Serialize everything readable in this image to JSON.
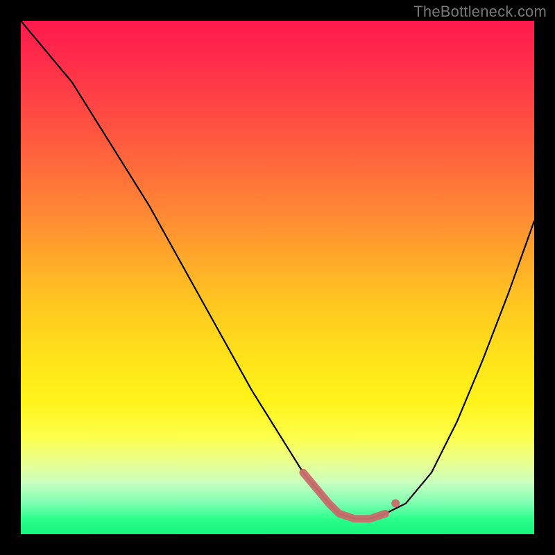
{
  "attribution": "TheBottleneck.com",
  "chart_data": {
    "type": "line",
    "title": "",
    "xlabel": "",
    "ylabel": "",
    "xlim": [
      0,
      100
    ],
    "ylim": [
      0,
      100
    ],
    "series": [
      {
        "name": "bottleneck-curve",
        "x": [
          0,
          5,
          10,
          15,
          20,
          25,
          30,
          35,
          40,
          45,
          50,
          55,
          60,
          62,
          65,
          68,
          71,
          75,
          80,
          85,
          90,
          95,
          100
        ],
        "y": [
          100,
          94,
          88,
          80,
          72,
          64,
          55,
          46,
          37,
          28,
          20,
          12,
          6,
          4,
          3,
          3,
          4,
          6,
          12,
          22,
          34,
          47,
          61
        ]
      }
    ],
    "optimal_range": {
      "x_start": 55,
      "x_end": 71,
      "y": 5
    },
    "optimal_dot": {
      "x": 73,
      "y": 6
    },
    "gradient_stops": [
      {
        "pos": 0,
        "color": "#ff1a4d",
        "meaning": "severe-bottleneck"
      },
      {
        "pos": 50,
        "color": "#ffe41a",
        "meaning": "moderate"
      },
      {
        "pos": 100,
        "color": "#14f57c",
        "meaning": "balanced"
      }
    ]
  }
}
